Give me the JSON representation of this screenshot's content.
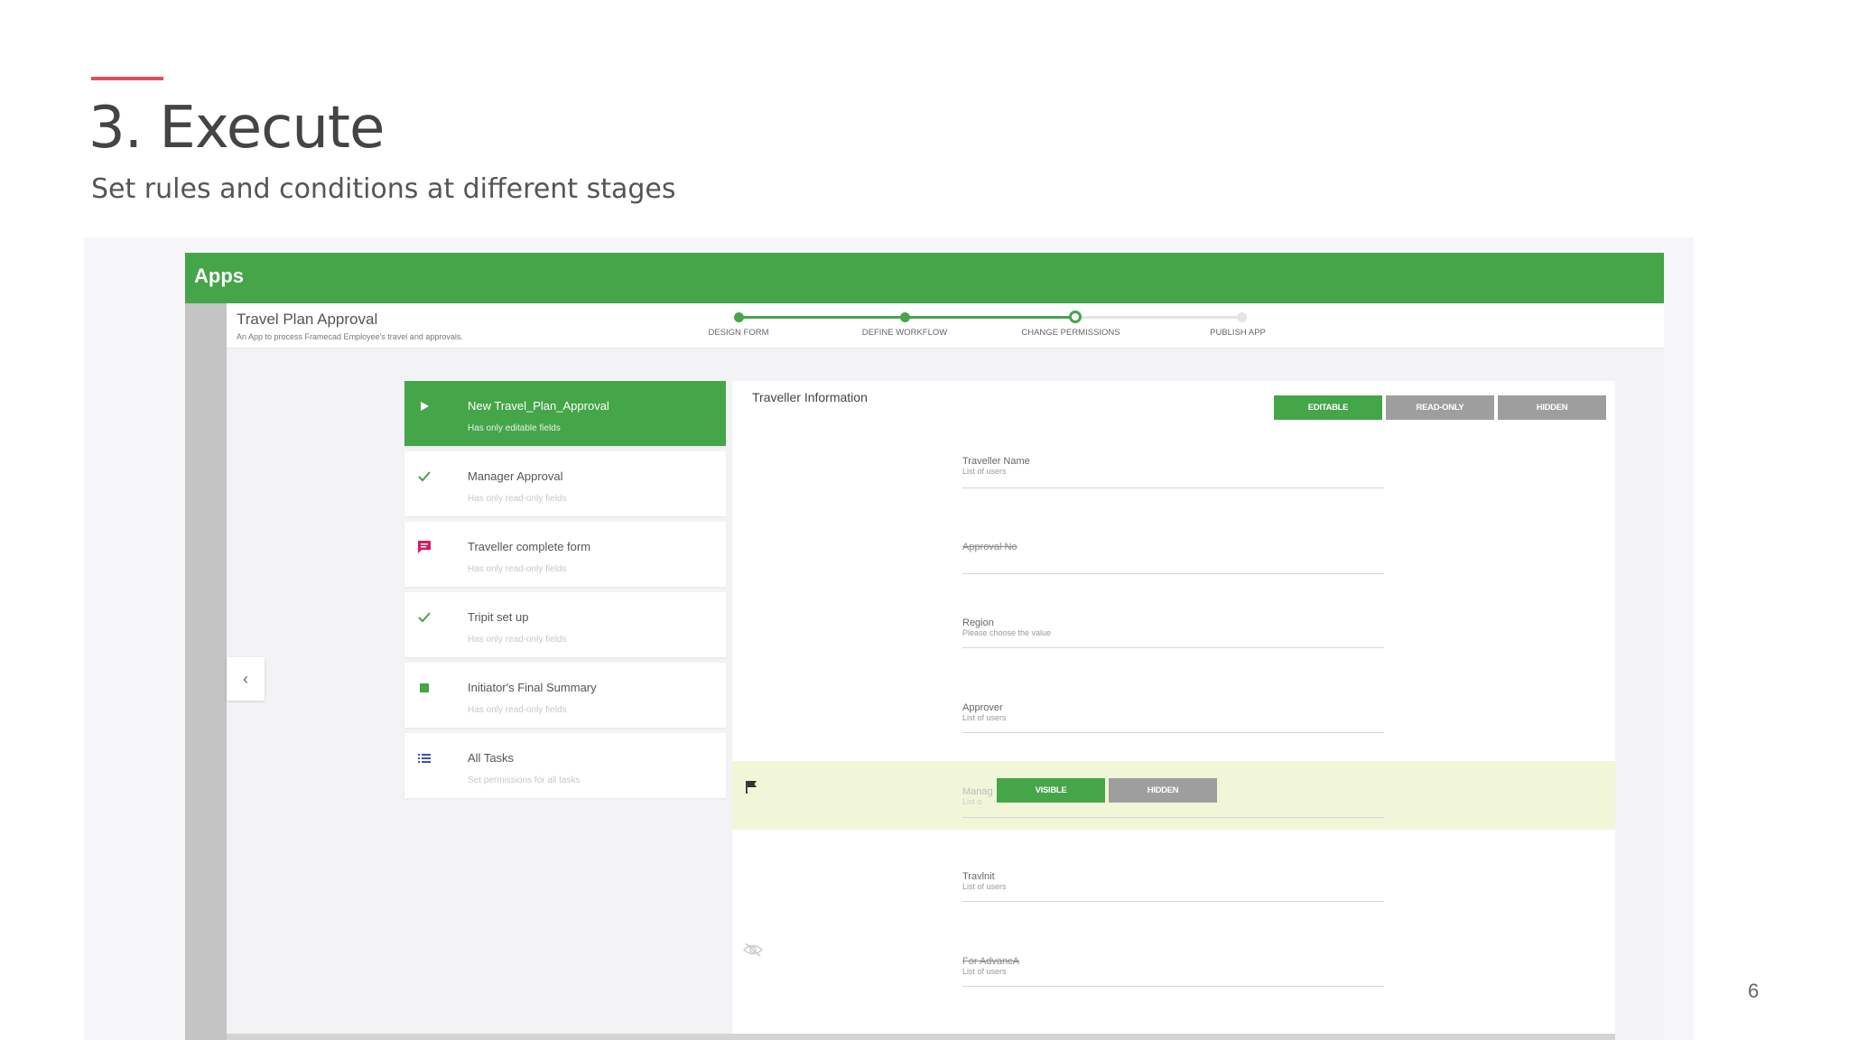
{
  "slide": {
    "title": "3. Execute",
    "subtitle": "Set rules and conditions at different stages",
    "page_number": "6",
    "accent_color": "#e0505a"
  },
  "app": {
    "header_label": "Apps",
    "brand_color": "#45a549",
    "title": "Travel Plan Approval",
    "description": "An App to process Framecad Employee's travel and approvals."
  },
  "stepper": {
    "steps": [
      {
        "label": "DESIGN FORM",
        "state": "done"
      },
      {
        "label": "DEFINE WORKFLOW",
        "state": "done"
      },
      {
        "label": "CHANGE PERMISSIONS",
        "state": "current"
      },
      {
        "label": "PUBLISH APP",
        "state": "future"
      }
    ]
  },
  "tasks": [
    {
      "title": "New Travel_Plan_Approval",
      "subtitle": "Has only editable fields",
      "icon": "play-icon",
      "active": true
    },
    {
      "title": "Manager Approval",
      "subtitle": "Has only read-only fields",
      "icon": "check-icon",
      "active": false
    },
    {
      "title": "Traveller complete form",
      "subtitle": "Has only read-only fields",
      "icon": "comment-icon",
      "active": false
    },
    {
      "title": "Tripit set up",
      "subtitle": "Has only read-only fields",
      "icon": "check-icon",
      "active": false
    },
    {
      "title": "Initiator's Final Summary",
      "subtitle": "Has only read-only fields",
      "icon": "square-icon",
      "active": false
    },
    {
      "title": "All Tasks",
      "subtitle": "Set permissions for all tasks",
      "icon": "list-icon",
      "active": false
    }
  ],
  "form": {
    "section_title": "Traveller Information",
    "perm_buttons": {
      "editable": "EDITABLE",
      "read_only": "READ-ONLY",
      "hidden": "HIDDEN"
    },
    "fields": [
      {
        "label": "Traveller Name",
        "sub": "List of users",
        "struck": false
      },
      {
        "label": "Approval No",
        "sub": "",
        "struck": true
      },
      {
        "label": "Region",
        "sub": "Please choose the value",
        "struck": false
      },
      {
        "label": "Approver",
        "sub": "List of users",
        "struck": false
      },
      {
        "label": "Manag",
        "sub": "List o",
        "struck": false
      },
      {
        "label": "Travlnit",
        "sub": "List of users",
        "struck": false
      },
      {
        "label": "For AdvancA",
        "sub": "List of users",
        "struck": true
      }
    ],
    "row_buttons": {
      "visible": "VISIBLE",
      "hidden": "HIDDEN"
    }
  }
}
